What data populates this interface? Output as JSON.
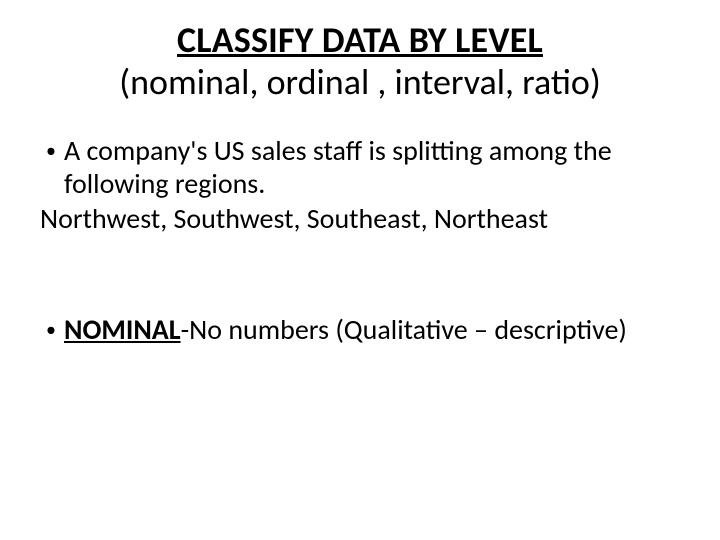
{
  "title": {
    "main": "CLASSIFY DATA BY LEVEL",
    "sub": "(nominal, ordinal , interval, ratio)"
  },
  "body": {
    "bullet1": "A company's US sales staff is splitting among the following regions.",
    "line_regions": "Northwest, Southwest, Southeast, Northeast",
    "bullet2_strong": "NOMINAL",
    "bullet2_rest": "-No numbers (Qualitative – descriptive)"
  }
}
